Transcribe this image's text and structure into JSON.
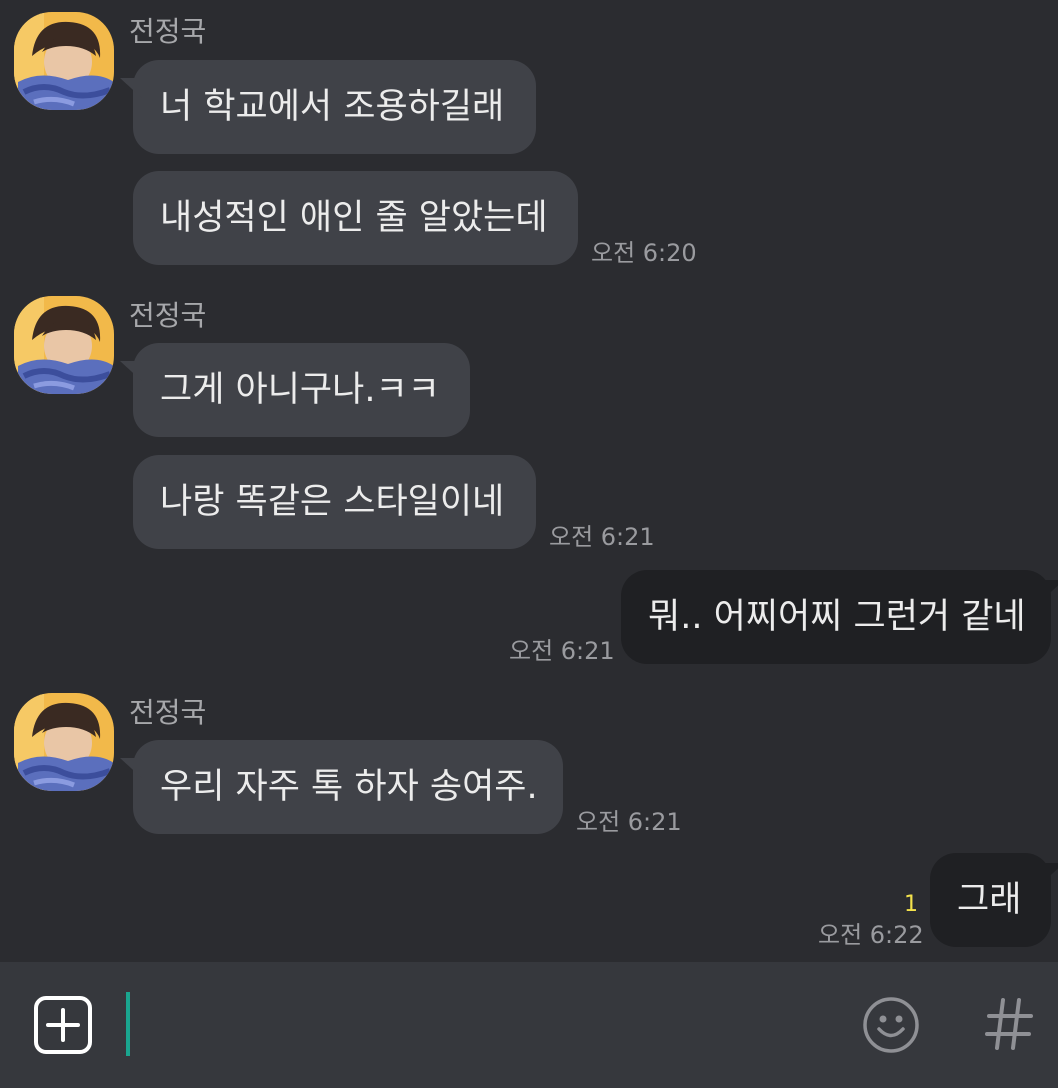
{
  "messages": [
    {
      "sender": "전정국",
      "text": "너 학교에서 조용하길래"
    },
    {
      "text": "내성적인 애인 줄 알았는데",
      "time": "오전 6:20"
    },
    {
      "sender": "전정국",
      "text": "그게 아니구나.ㅋㅋ"
    },
    {
      "text": "나랑 똑같은 스타일이네",
      "time": "오전 6:21"
    },
    {
      "text": "뭐.. 어찌어찌 그런거 같네",
      "time": "오전 6:21",
      "outgoing": true
    },
    {
      "sender": "전정국",
      "text": "우리 자주 톡 하자 송여주.",
      "time": "오전 6:21"
    },
    {
      "text": "그래",
      "time": "오전 6:22",
      "unread": "1",
      "outgoing": true
    }
  ],
  "input_bar": {
    "add_icon": "plus-square-icon",
    "emoji_icon": "smiley-icon",
    "hash_icon": "hash-icon"
  },
  "colors": {
    "background": "#2b2c30",
    "incoming_bubble": "#404248",
    "outgoing_bubble": "#1f2023",
    "unread": "#f4e24c",
    "cursor": "#1aa58f"
  }
}
